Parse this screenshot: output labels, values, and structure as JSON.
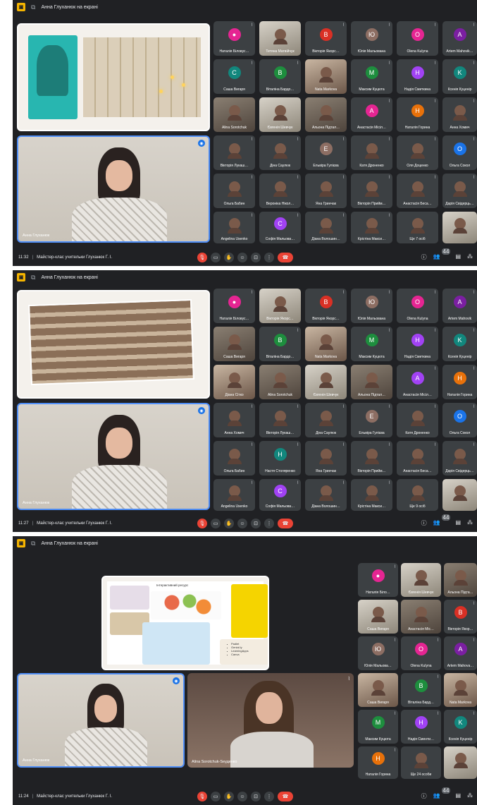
{
  "screenshots": [
    {
      "presenter_title": "Анна Глуханюк на екрані",
      "time": "11:32",
      "meeting_title": "Майстер-клас учительки Глуханюк Г. І.",
      "speaker_name": "Анна Глуханюк",
      "participants_badge": "44",
      "grid": [
        [
          "Наталія Біловус…",
          "Тетяна Матвійчук",
          "Вікторія Якорс…",
          "Юлія Мальована",
          "Olena Kulyna",
          "Artem Mahovik…"
        ],
        [
          "Саша Вигаря",
          "Віталіна Бардо…",
          "Nata Markova",
          "Максим Куцюта",
          "Надія Смиткина",
          "Ксенія Куценір"
        ],
        [
          "Alina Sorotchuk",
          "Євгенія Шевчук",
          "Альона Підтал…",
          "Анастасія Місіл…",
          "Наталія Горина",
          "Анна Хомич"
        ],
        [
          "Вікторія Лукаш…",
          "Діна Саулюк",
          "Ельвіра Гулієва",
          "Катя Дроненко",
          "Оля Доценко",
          "Ольга Сокол"
        ],
        [
          "Ольга Бабин",
          "Вероніка Нікол…",
          "Яна Гринчак",
          "Вікторія Прийм…",
          "Анастасія Беса…",
          "Дарія Свідерць…"
        ],
        [
          "Angelina Usenko",
          "Софія Мальова…",
          "Діана Волошин…",
          "Крістіна Макси…",
          "Ще 7 осіб",
          ""
        ]
      ]
    },
    {
      "presenter_title": "Анна Глуханюк на екрані",
      "time": "11:27",
      "meeting_title": "Майстер-клас учительки Глуханюк Г. І.",
      "speaker_name": "Анна Глуханюк",
      "participants_badge": "44",
      "grid": [
        [
          "Наталія Біловус…",
          "Вікторія Якорс…",
          "Вікторія Якорс…",
          "Юлія Мальована",
          "Olena Kulyna",
          "Artem Mahovik"
        ],
        [
          "Саша Вигаря",
          "Віталіна Бардо…",
          "Nata Markova",
          "Максим Куцюта",
          "Надія Смиткина",
          "Ксенія Куценір"
        ],
        [
          "Діана Сітко",
          "Alina Sorotchuk",
          "Євгенія Шевчук",
          "Альона Підтал…",
          "Анастасія Місіл…",
          "Наталія Горина"
        ],
        [
          "Анна Хомич",
          "Вікторія Лукаш…",
          "Діна Саулюк",
          "Ельвіра Гулієва",
          "Катя Дроненко",
          "Ольга Сокол"
        ],
        [
          "Ольга Бабин",
          "Настя Столяренко",
          "Яна Гринчак",
          "Вікторія Прийм…",
          "Анастасія Беса…",
          "Дарія Свідерць…"
        ],
        [
          "Angelina Usenko",
          "Софія Мальова…",
          "Діана Волошин…",
          "Крістіна Макси…",
          "Ще 9 осіб",
          ""
        ]
      ]
    },
    {
      "presenter_title": "Анна Глуханюк на екрані",
      "time": "11:24",
      "meeting_title": "Майстер-клас учительки Глуханюк Г. І.",
      "speaker_name": "Анна Глуханюк",
      "second_speaker_name": "Alina Sorotchuk-Sеуденко",
      "participants_badge": "44",
      "slide_title": "Інтерактивний ресурс",
      "slide_list": [
        "Padlet",
        "Genial.ly",
        "LearningApps",
        "Canva"
      ],
      "grid": [
        [
          "Наталія Біло…",
          "Євгенія Шевчук",
          "Альона Підта…"
        ],
        [
          "Саша Вигаря",
          "Анастасія Міс…",
          "Вікторія Якор…"
        ],
        [
          "Юлія Мальова…",
          "Olena Kulyna",
          "Artem Mahova…"
        ],
        [
          "Саша Вигаря",
          "Віталіна Бард…",
          "Nata Markova"
        ],
        [
          "Максим Куцюта",
          "Надія Сменти…",
          "Ксенія Куценір"
        ],
        [
          "Наталія Горина",
          "Ще 24 особи",
          ""
        ]
      ]
    }
  ],
  "avatar_colors": {
    "red": "#d93025",
    "green": "#1e8e3e",
    "teal": "#12877d",
    "purple": "#a142f4",
    "pink": "#e52592",
    "orange": "#e8710a",
    "brown": "#8d6e63",
    "blue": "#1a73e8",
    "violet": "#7b1fa2"
  },
  "icons": {
    "mic": "mic-off-icon",
    "camera": "camera-icon",
    "hand": "raise-hand-icon",
    "emoji": "emoji-icon",
    "present": "present-icon",
    "more": "more-icon",
    "hangup": "hangup-icon",
    "info": "info-icon",
    "people": "people-icon",
    "chat": "chat-icon",
    "activities": "activities-icon"
  }
}
